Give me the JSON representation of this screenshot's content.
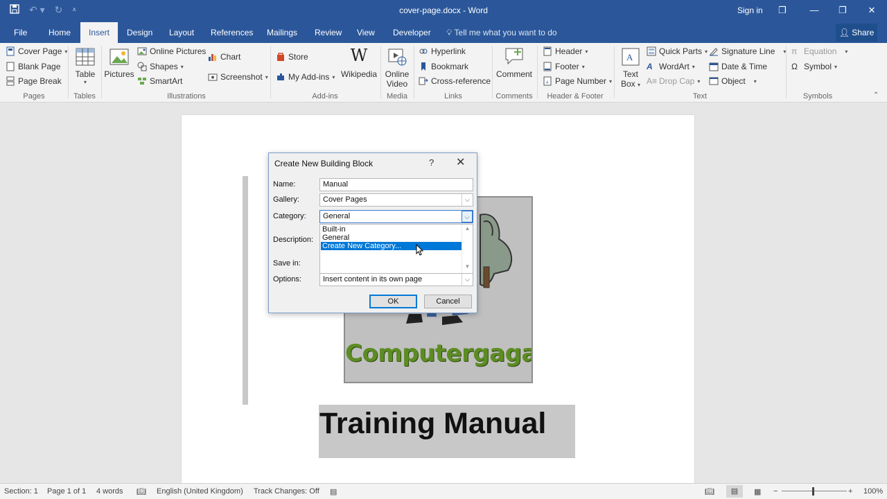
{
  "titlebar": {
    "title": "cover-page.docx - Word",
    "sign_in": "Sign in",
    "save_icon": "save-icon",
    "undo_icon": "undo-icon",
    "redo_icon": "redo-icon",
    "customize_icon": "customize-qat-icon",
    "restore_ribbon": "❐",
    "minimize": "—",
    "maximize": "❐",
    "close": "✕"
  },
  "tabs": {
    "file": "File",
    "home": "Home",
    "insert": "Insert",
    "design": "Design",
    "layout": "Layout",
    "references": "References",
    "mailings": "Mailings",
    "review": "Review",
    "view": "View",
    "developer": "Developer",
    "tell_me": "Tell me what you want to do",
    "share": "Share"
  },
  "ribbon": {
    "pages": {
      "cover_page": "Cover Page",
      "blank_page": "Blank Page",
      "page_break": "Page Break",
      "label": "Pages"
    },
    "tables": {
      "table": "Table",
      "label": "Tables"
    },
    "illustrations": {
      "pictures": "Pictures",
      "online_pictures": "Online Pictures",
      "shapes": "Shapes",
      "smartart": "SmartArt",
      "chart": "Chart",
      "screenshot": "Screenshot",
      "label": "Illustrations"
    },
    "addins": {
      "store": "Store",
      "my_addins": "My Add-ins",
      "wikipedia": "Wikipedia",
      "label": "Add-ins"
    },
    "media": {
      "online_video_1": "Online",
      "online_video_2": "Video",
      "label": "Media"
    },
    "links": {
      "hyperlink": "Hyperlink",
      "bookmark": "Bookmark",
      "cross_reference": "Cross-reference",
      "label": "Links"
    },
    "comments": {
      "comment": "Comment",
      "label": "Comments"
    },
    "header_footer": {
      "header": "Header",
      "footer": "Footer",
      "page_number": "Page Number",
      "label": "Header & Footer"
    },
    "text": {
      "text_box_1": "Text",
      "text_box_2": "Box",
      "quick_parts": "Quick Parts",
      "wordart": "WordArt",
      "drop_cap": "Drop Cap",
      "signature_line": "Signature Line",
      "date_time": "Date & Time",
      "object": "Object",
      "label": "Text"
    },
    "symbols": {
      "equation": "Equation",
      "symbol": "Symbol",
      "label": "Symbols"
    }
  },
  "document": {
    "logo_text": "Computergaga",
    "heading": "Training Manual"
  },
  "dialog": {
    "title": "Create New Building Block",
    "help": "?",
    "close": "✕",
    "name_label": "Name:",
    "name_value": "Manual",
    "gallery_label": "Gallery:",
    "gallery_value": "Cover Pages",
    "category_label": "Category:",
    "category_value": "General",
    "category_options": [
      "Built-in",
      "General",
      "Create New Category..."
    ],
    "selected_option": "Create New Category...",
    "description_label": "Description:",
    "save_in_label": "Save in:",
    "options_label": "Options:",
    "options_value": "Insert content in its own page",
    "ok": "OK",
    "cancel": "Cancel"
  },
  "statusbar": {
    "section": "Section: 1",
    "page": "Page 1 of 1",
    "words": "4 words",
    "language": "English (United Kingdom)",
    "track_changes": "Track Changes: Off",
    "zoom": "100%",
    "zoom_out": "−",
    "zoom_in": "+"
  },
  "colors": {
    "word_blue": "#2b579a",
    "selection_blue": "#0078d7",
    "logo_green": "#5d8c24"
  }
}
